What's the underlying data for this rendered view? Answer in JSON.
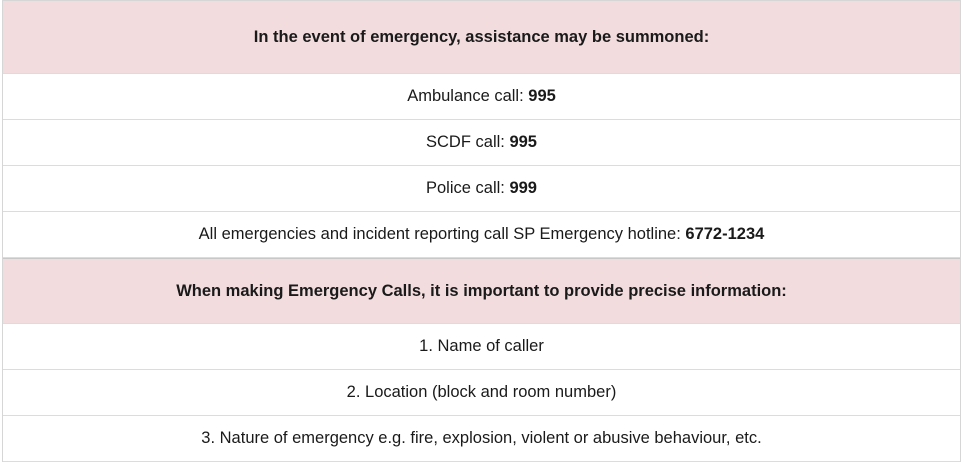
{
  "section1": {
    "heading": "In the event of emergency, assistance may be summoned:",
    "items": [
      {
        "label": "Ambulance call: ",
        "number": "995"
      },
      {
        "label": "SCDF call: ",
        "number": "995"
      },
      {
        "label": "Police call: ",
        "number": "999"
      },
      {
        "label": "All emergencies and incident reporting call SP Emergency hotline: ",
        "number": "6772-1234"
      }
    ]
  },
  "section2": {
    "heading": "When making Emergency Calls, it is important to provide precise information:",
    "items": [
      "1. Name of caller",
      "2. Location (block and room number)",
      "3. Nature of emergency e.g. fire, explosion, violent or abusive behaviour, etc."
    ]
  }
}
